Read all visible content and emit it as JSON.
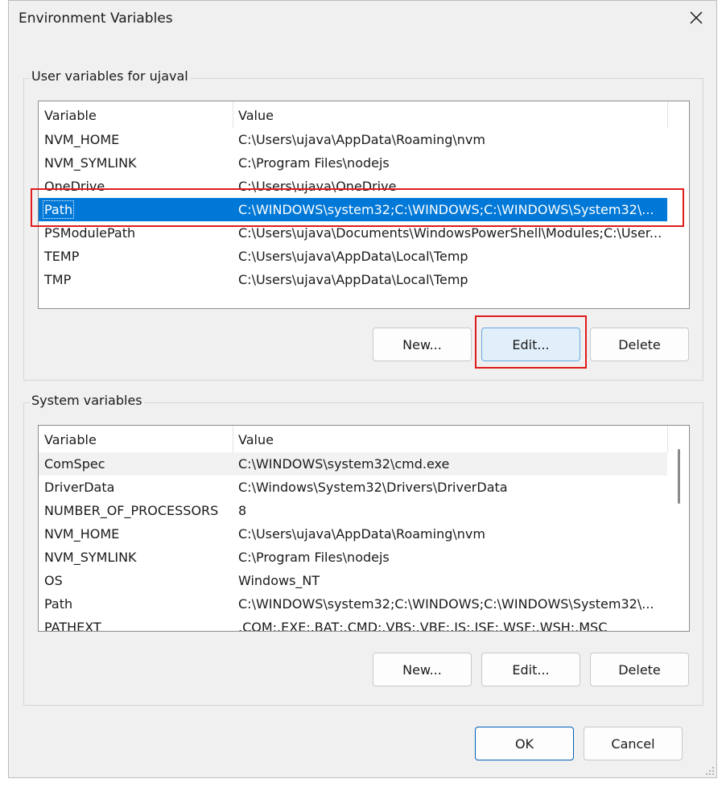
{
  "window": {
    "title": "Environment Variables"
  },
  "user_group": {
    "label": "User variables for ujaval",
    "columns": {
      "variable": "Variable",
      "value": "Value"
    },
    "rows": [
      {
        "name": "NVM_HOME",
        "value": "C:\\Users\\ujava\\AppData\\Roaming\\nvm"
      },
      {
        "name": "NVM_SYMLINK",
        "value": "C:\\Program Files\\nodejs"
      },
      {
        "name": "OneDrive",
        "value": "C:\\Users\\ujava\\OneDrive"
      },
      {
        "name": "Path",
        "value": "C:\\WINDOWS\\system32;C:\\WINDOWS;C:\\WINDOWS\\System32\\..."
      },
      {
        "name": "PSModulePath",
        "value": "C:\\Users\\ujava\\Documents\\WindowsPowerShell\\Modules;C:\\User..."
      },
      {
        "name": "TEMP",
        "value": "C:\\Users\\ujava\\AppData\\Local\\Temp"
      },
      {
        "name": "TMP",
        "value": "C:\\Users\\ujava\\AppData\\Local\\Temp"
      }
    ],
    "selected_row": "Path",
    "buttons": {
      "new": "New...",
      "edit": "Edit...",
      "delete": "Delete"
    }
  },
  "system_group": {
    "label": "System variables",
    "columns": {
      "variable": "Variable",
      "value": "Value"
    },
    "rows": [
      {
        "name": "ComSpec",
        "value": "C:\\WINDOWS\\system32\\cmd.exe"
      },
      {
        "name": "DriverData",
        "value": "C:\\Windows\\System32\\Drivers\\DriverData"
      },
      {
        "name": "NUMBER_OF_PROCESSORS",
        "value": "8"
      },
      {
        "name": "NVM_HOME",
        "value": "C:\\Users\\ujava\\AppData\\Roaming\\nvm"
      },
      {
        "name": "NVM_SYMLINK",
        "value": "C:\\Program Files\\nodejs"
      },
      {
        "name": "OS",
        "value": "Windows_NT"
      },
      {
        "name": "Path",
        "value": "C:\\WINDOWS\\system32;C:\\WINDOWS;C:\\WINDOWS\\System32\\..."
      },
      {
        "name": "PATHEXT",
        "value": ".COM;.EXE;.BAT;.CMD;.VBS;.VBE;.JS;.JSE;.WSF;.WSH;.MSC"
      }
    ],
    "buttons": {
      "new": "New...",
      "edit": "Edit...",
      "delete": "Delete"
    }
  },
  "footer": {
    "ok": "OK",
    "cancel": "Cancel"
  },
  "colors": {
    "selection": "#0078d7",
    "highlight_box": "#e01b1b",
    "focus_button": "#e1effa"
  },
  "icons": {
    "close": "close-icon",
    "resize": "resize-grip-icon"
  }
}
